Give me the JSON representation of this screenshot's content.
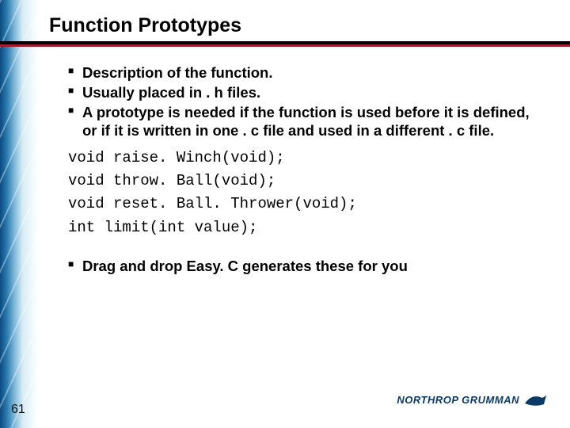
{
  "title": "Function Prototypes",
  "bullets1": {
    "b0": "Description of the function.",
    "b1": "Usually placed in . h files.",
    "b2": "A prototype is needed if the function is used before it is defined, or if it is written in one . c file and used in a different . c file."
  },
  "code": {
    "l0": "void raise. Winch(void);",
    "l1": "void throw. Ball(void);",
    "l2": "void reset. Ball. Thrower(void);",
    "l3": "int limit(int value);"
  },
  "bullets2": {
    "b0": "Drag and drop Easy. C generates these for you"
  },
  "page_number": "61",
  "logo_text": "NORTHROP GRUMMAN"
}
